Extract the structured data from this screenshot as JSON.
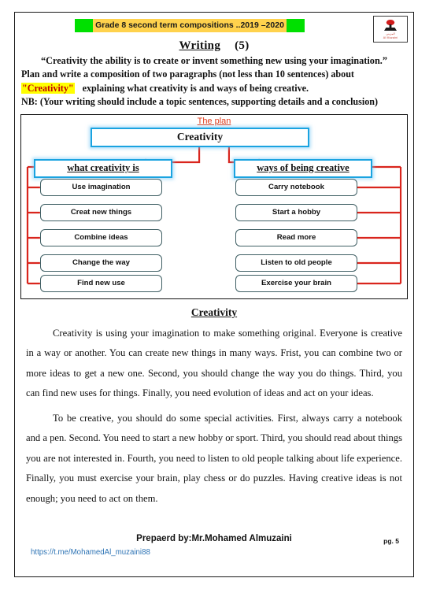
{
  "header": {
    "title_banner": "Grade 8  second  term compositions ..2019 –2020",
    "section_heading": "Writing",
    "section_number": "(5)",
    "logo": {
      "icon": "stamp-icon",
      "brand_latin": "Al Muzaini",
      "brand_arabic": "المزيني"
    }
  },
  "prompt": {
    "quote": "“Creativity the ability is to create or invent something new using your imagination.”",
    "line1": "Plan and write a composition of two paragraphs (not less than 10 sentences) about",
    "topic_highlight": "\"Creativity\"",
    "line2_rest": "explaining  what creativity is and ways of being creative.",
    "note": "NB: (Your writing should include a topic sentences, supporting details and a conclusion)"
  },
  "diagram": {
    "label": "The plan",
    "root": "Creativity",
    "left_branch": {
      "heading": "what creativity is",
      "items": [
        "Use imagination",
        "Creat new things",
        "Combine ideas",
        "Change the way",
        "Find new use"
      ]
    },
    "right_branch": {
      "heading": "ways of being creative",
      "items": [
        "Carry notebook",
        "Start a hobby",
        "Read more",
        "Listen to old people",
        "Exercise your brain"
      ]
    },
    "colors": {
      "box_border": "#1aa3e0",
      "leaf_border": "#3f5f64",
      "connector": "#d9251d",
      "label": "#e03a1a"
    }
  },
  "essay": {
    "title": "Creativity",
    "paragraph1": "Creativity is using your imagination to make something original. Everyone is creative in a way or another. You can create new things in many ways. Frist, you can combine two or more ideas to get a new one. Second, you should change the way you do things. Third, you can find new uses for things. Finally, you need evolution of ideas and act on your ideas.",
    "paragraph2": "To be creative, you should do some special activities. First, always carry a notebook and a pen. Second. You need to start a new hobby or sport. Third, you should read about things you are not interested in. Fourth, you need to listen to old people talking about life experience. Finally, you must exercise your brain, play chess or do puzzles. Having creative ideas is not enough; you need to act on them."
  },
  "footer": {
    "prepared_by": "Prepaerd by:Mr.Mohamed Almuzaini",
    "page_number": "pg. 5",
    "telegram_link": "https://t.me/MohamedAl_muzaini88"
  }
}
